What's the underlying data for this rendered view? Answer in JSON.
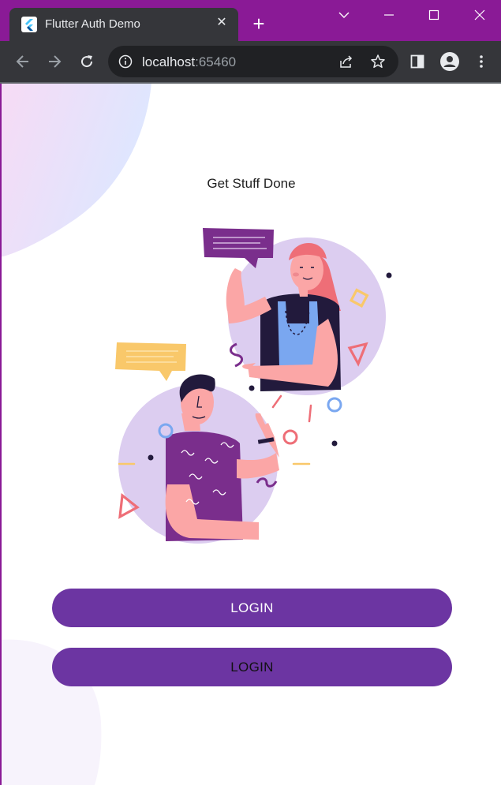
{
  "browser": {
    "tab_title": "Flutter Auth Demo",
    "url_host": "localhost",
    "url_port": ":65460"
  },
  "page": {
    "heading": "Get Stuff Done",
    "primary_button": "LOGIN",
    "secondary_button": "LOGIN"
  },
  "colors": {
    "titlebar": "#8a1a96",
    "button": "#6c35a2",
    "circle": "#dccdf0"
  }
}
